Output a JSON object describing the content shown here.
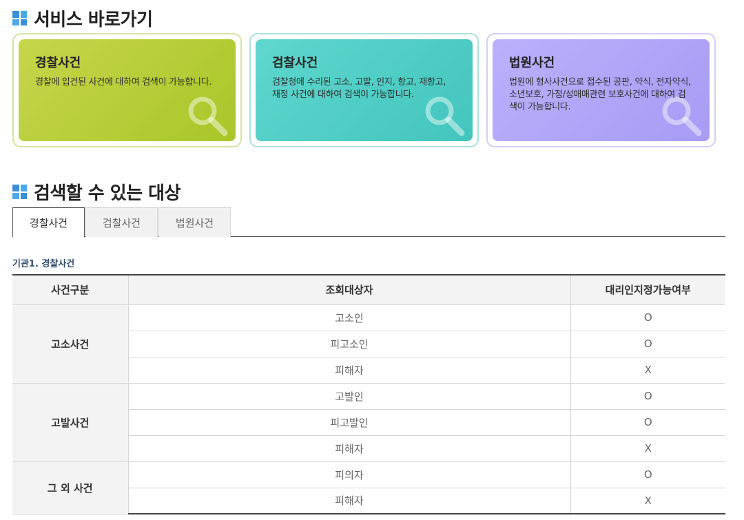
{
  "service_section": {
    "title": "서비스 바로가기",
    "cards": [
      {
        "title": "경찰사건",
        "desc": "경찰에 입건된 사건에 대하여 검색이 가능합니다."
      },
      {
        "title": "검찰사건",
        "desc": "검찰청에 수리된 고소, 고발, 인지, 항고, 재항고, 재정 사건에 대하여 검색이 가능합니다."
      },
      {
        "title": "법원사건",
        "desc": "법원에 형사사건으로 접수된 공판, 약식, 전자약식, 소년보호, 가정/성매매관련 보호사건에 대하여 검색이 가능합니다."
      }
    ]
  },
  "target_section": {
    "title": "검색할 수 있는 대상",
    "tabs": [
      {
        "label": "경찰사건",
        "active": true
      },
      {
        "label": "검찰사건",
        "active": false
      },
      {
        "label": "법원사건",
        "active": false
      }
    ],
    "subheading": "기관1. 경찰사건",
    "table": {
      "headers": [
        "사건구분",
        "조회대상자",
        "대리인지정가능여부"
      ],
      "groups": [
        {
          "category": "고소사건",
          "rows": [
            {
              "target": "고소인",
              "proxy": "O"
            },
            {
              "target": "피고소인",
              "proxy": "O"
            },
            {
              "target": "피해자",
              "proxy": "X"
            }
          ]
        },
        {
          "category": "고발사건",
          "rows": [
            {
              "target": "고발인",
              "proxy": "O"
            },
            {
              "target": "피고발인",
              "proxy": "O"
            },
            {
              "target": "피해자",
              "proxy": "X"
            }
          ]
        },
        {
          "category": "그 외 사건",
          "rows": [
            {
              "target": "피의자",
              "proxy": "O"
            },
            {
              "target": "피해자",
              "proxy": "X"
            }
          ]
        }
      ]
    }
  },
  "icons": {
    "section_bullet": "windows-grid-icon",
    "card_decoration": "magnifier-icon"
  }
}
